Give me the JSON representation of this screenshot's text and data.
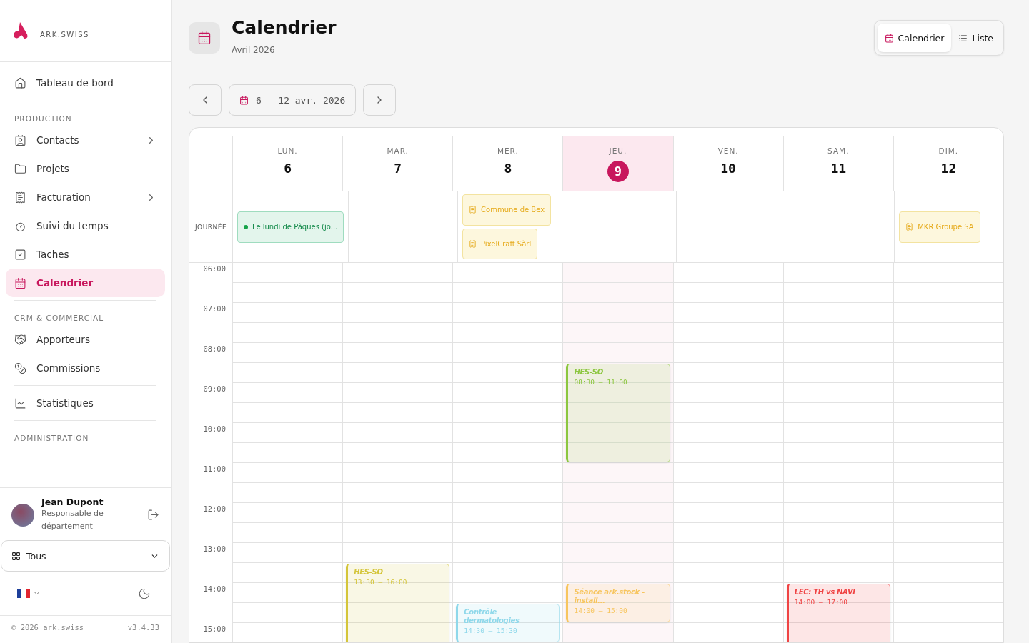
{
  "sidebar": {
    "logo": "ARK.SWISS",
    "nav": [
      {
        "items": [
          {
            "label": "Tableau de bord",
            "selected": false,
            "expandable": false
          }
        ]
      },
      {
        "heading": "PRODUCTION",
        "items": [
          {
            "label": "Contacts",
            "selected": false,
            "expandable": true
          },
          {
            "label": "Projets",
            "selected": false,
            "expandable": false
          },
          {
            "label": "Facturation",
            "selected": false,
            "expandable": true
          },
          {
            "label": "Suivi du temps",
            "selected": false,
            "expandable": false
          },
          {
            "label": "Taches",
            "selected": false,
            "expandable": false
          },
          {
            "label": "Calendrier",
            "selected": true,
            "expandable": false
          }
        ]
      },
      {
        "heading": "CRM & COMMERCIAL",
        "items": [
          {
            "label": "Apporteurs",
            "selected": false,
            "expandable": false
          },
          {
            "label": "Commissions",
            "selected": false,
            "expandable": false
          }
        ]
      },
      {
        "items": [
          {
            "label": "Statistiques",
            "selected": false,
            "expandable": false
          }
        ]
      },
      {
        "heading": "ADMINISTRATION"
      }
    ],
    "user": {
      "name": "Jean Dupont",
      "role": "Responsable de département"
    },
    "workspace": {
      "value": "Tous"
    },
    "footer": {
      "copyright": "© 2026 ark.swiss",
      "version": "v3.4.33"
    }
  },
  "page": {
    "title": "Calendrier",
    "subtitle": "Avril 2026",
    "range": "6 – 12 avr. 2026",
    "view_toggle": [
      {
        "label": "Calendrier",
        "selected": true
      },
      {
        "label": "Liste",
        "selected": false
      }
    ]
  },
  "calendar": {
    "allday_label": "JOURNÉE",
    "hours": [
      "06:00",
      "07:00",
      "08:00",
      "09:00",
      "10:00",
      "11:00",
      "12:00",
      "13:00",
      "14:00",
      "15:00"
    ],
    "days": [
      {
        "weekday": "LUN.",
        "date": "6",
        "today": false,
        "allday": [
          {
            "kind": "holiday",
            "title": "Le lundi de Pâques (jo..."
          }
        ]
      },
      {
        "weekday": "MAR.",
        "date": "7",
        "today": false,
        "events": [
          {
            "title": "HES-SO",
            "time": "13:30 – 16:00",
            "color": "#d4c53a"
          }
        ]
      },
      {
        "weekday": "MER.",
        "date": "8",
        "today": false,
        "allday": [
          {
            "kind": "invoice",
            "title": "Commune de Bex"
          },
          {
            "kind": "invoice",
            "title": "PixelCraft Sàrl"
          }
        ],
        "events": [
          {
            "title": "Contrôle dermatologies",
            "time": "14:30 – 15:30",
            "color": "#8fd8ea"
          }
        ]
      },
      {
        "weekday": "JEU.",
        "date": "9",
        "today": true,
        "events": [
          {
            "title": "HES-SO",
            "time": "08:30 – 11:00",
            "color": "#8cc63f"
          },
          {
            "title": "Séance ark.stock - install...",
            "time": "14:00 – 15:00",
            "color": "#f7c55e"
          }
        ]
      },
      {
        "weekday": "VEN.",
        "date": "10",
        "today": false
      },
      {
        "weekday": "SAM.",
        "date": "11",
        "today": false,
        "events": [
          {
            "title": "LEC: TH vs NAVI",
            "time": "14:00 – 17:00",
            "color": "#ef4444"
          }
        ]
      },
      {
        "weekday": "DIM.",
        "date": "12",
        "today": false,
        "allday": [
          {
            "kind": "invoice",
            "title": "MKR Groupe SA"
          }
        ]
      }
    ]
  }
}
